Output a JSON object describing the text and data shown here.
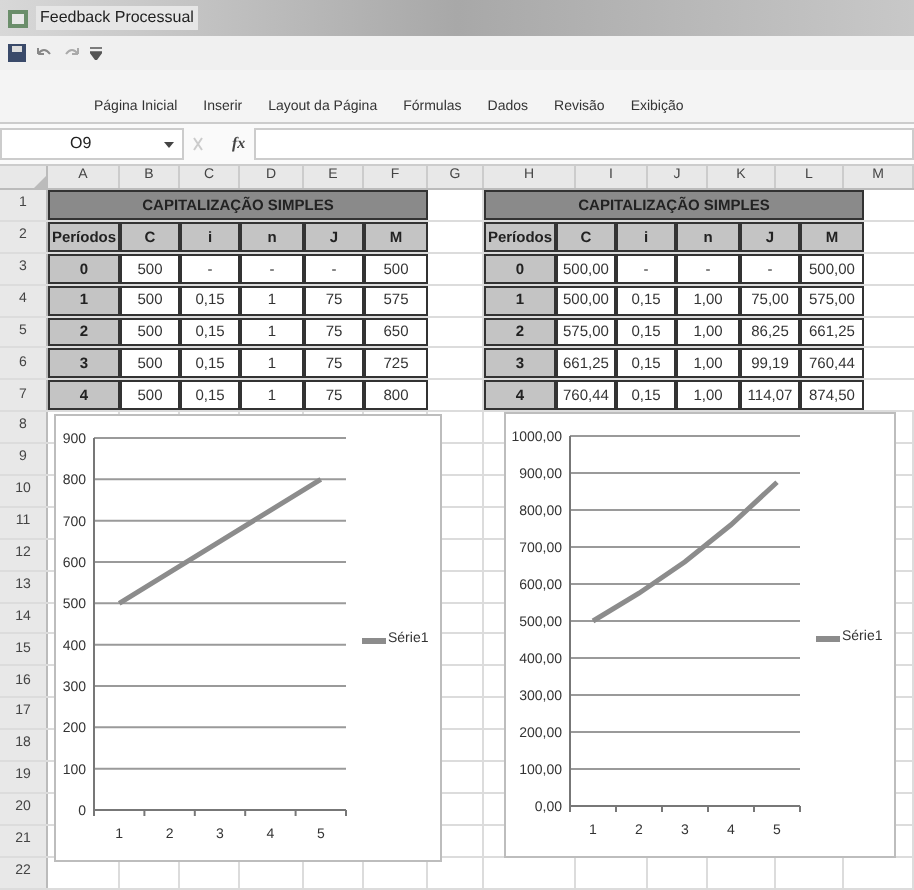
{
  "window": {
    "title": "Feedback Processual"
  },
  "ribbon_tabs": [
    {
      "label": "Página Inicial"
    },
    {
      "label": "Inserir"
    },
    {
      "label": "Layout da Página"
    },
    {
      "label": "Fórmulas"
    },
    {
      "label": "Dados"
    },
    {
      "label": "Revisão"
    },
    {
      "label": "Exibição"
    }
  ],
  "formula_bar": {
    "name_box": "O9",
    "function_label": "fx"
  },
  "column_headers": [
    "A",
    "B",
    "C",
    "D",
    "E",
    "F",
    "G",
    "H",
    "I",
    "J",
    "K",
    "L",
    "M"
  ],
  "row_headers": [
    "1",
    "2",
    "3",
    "4",
    "5",
    "6",
    "7",
    "8",
    "9",
    "10",
    "11",
    "12",
    "13",
    "14",
    "15",
    "16",
    "17",
    "18",
    "19",
    "20",
    "21",
    "22"
  ],
  "left_table": {
    "title": "CAPITALIZAÇÃO SIMPLES",
    "columns": [
      "Períodos",
      "C",
      "i",
      "n",
      "J",
      "M"
    ],
    "rows": [
      [
        "0",
        "500",
        "-",
        "-",
        "-",
        "500"
      ],
      [
        "1",
        "500",
        "0,15",
        "1",
        "75",
        "575"
      ],
      [
        "2",
        "500",
        "0,15",
        "1",
        "75",
        "650"
      ],
      [
        "3",
        "500",
        "0,15",
        "1",
        "75",
        "725"
      ],
      [
        "4",
        "500",
        "0,15",
        "1",
        "75",
        "800"
      ]
    ]
  },
  "right_table": {
    "title": "CAPITALIZAÇÃO SIMPLES",
    "columns": [
      "Períodos",
      "C",
      "i",
      "n",
      "J",
      "M"
    ],
    "rows": [
      [
        "0",
        "500,00",
        "-",
        "-",
        "-",
        "500,00"
      ],
      [
        "1",
        "500,00",
        "0,15",
        "1,00",
        "75,00",
        "575,00"
      ],
      [
        "2",
        "575,00",
        "0,15",
        "1,00",
        "86,25",
        "661,25"
      ],
      [
        "3",
        "661,25",
        "0,15",
        "1,00",
        "99,19",
        "760,44"
      ],
      [
        "4",
        "760,44",
        "0,15",
        "1,00",
        "114,07",
        "874,50"
      ]
    ]
  },
  "left_chart": {
    "chart_data": {
      "type": "line",
      "categories": [
        "1",
        "2",
        "3",
        "4",
        "5"
      ],
      "series": [
        {
          "name": "Série1",
          "color": "#8c8c8c",
          "values": [
            500,
            575,
            650,
            725,
            800
          ]
        }
      ],
      "ylim": [
        0,
        900
      ],
      "grid": true,
      "yticks": [
        0,
        100,
        200,
        300,
        400,
        500,
        600,
        700,
        800,
        900
      ]
    }
  },
  "right_chart": {
    "chart_data": {
      "type": "line",
      "categories": [
        "1",
        "2",
        "3",
        "4",
        "5"
      ],
      "series": [
        {
          "name": "Série1",
          "color": "#8c8c8c",
          "values": [
            500,
            575,
            660,
            760,
            875
          ]
        }
      ],
      "ylim": [
        0,
        1000
      ],
      "grid": true,
      "yticks": [
        {
          "value": 0,
          "label": "0,00"
        },
        {
          "value": 100,
          "label": "100,00"
        },
        {
          "value": 200,
          "label": "200,00"
        },
        {
          "value": 300,
          "label": "300,00"
        },
        {
          "value": 400,
          "label": "400,00"
        },
        {
          "value": 500,
          "label": "500,00"
        },
        {
          "value": 600,
          "label": "600,00"
        },
        {
          "value": 700,
          "label": "700,00"
        },
        {
          "value": 800,
          "label": "800,00"
        },
        {
          "value": 900,
          "label": "900,00"
        },
        {
          "value": 1000,
          "label": "1000,00"
        }
      ]
    }
  }
}
